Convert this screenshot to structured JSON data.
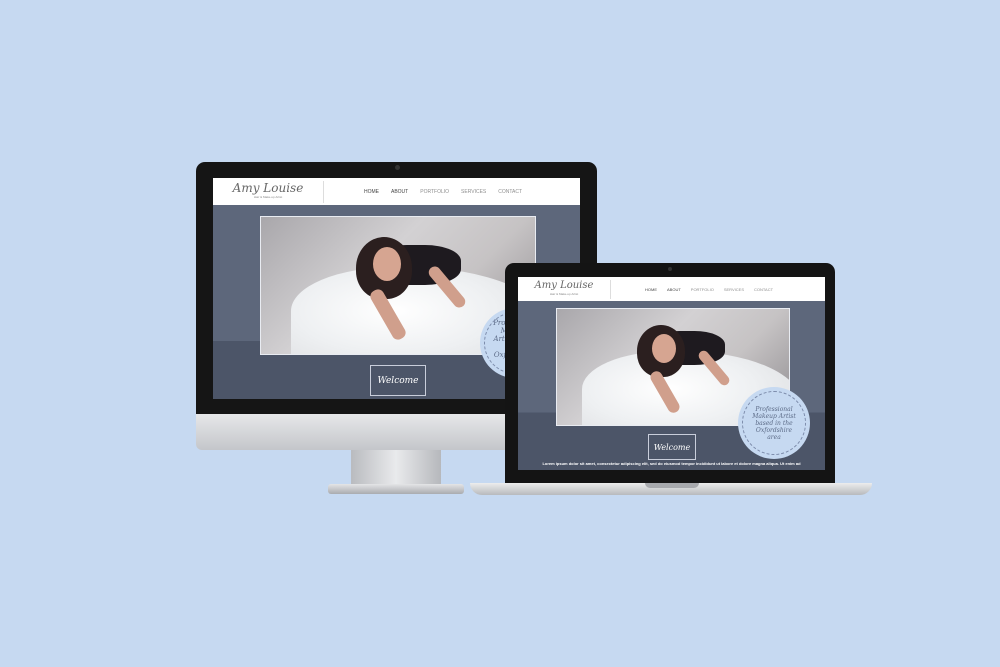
{
  "site": {
    "logo": "Amy Louise",
    "tagline": "Hair & Make-up Artist",
    "nav": [
      "HOME",
      "ABOUT",
      "PORTFOLIO",
      "SERVICES",
      "CONTACT"
    ],
    "welcome": "Welcome",
    "badge_text": "Professional Makeup Artist based in the Oxfordshire area",
    "lorem": "Lorem ipsum dolor sit amet, consectetur adipiscing elit, sed do eiusmod tempor incididunt ut labore et dolore magna aliqua. Ut enim ad"
  },
  "devices": [
    "desktop-monitor",
    "laptop"
  ],
  "colors": {
    "background": "#c6d9f1",
    "site_bg": "#4e586b",
    "badge": "#c6d9f1"
  }
}
